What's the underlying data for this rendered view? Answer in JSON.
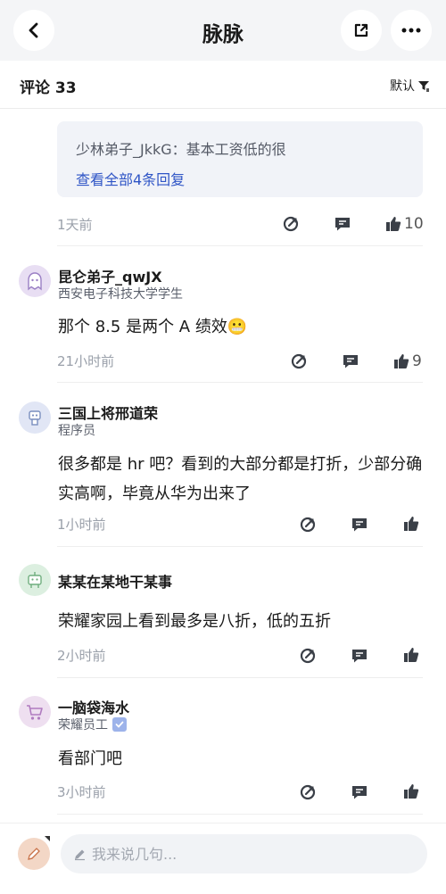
{
  "header": {
    "title": "脉脉"
  },
  "comments_header": {
    "title": "评论 33",
    "sort_label": "默认"
  },
  "thread": {
    "reply_preview": "少林弟子_JkkG：基本工资低的很",
    "view_all_replies": "查看全部4条回复",
    "time": "1天前",
    "like_count": "10"
  },
  "comments": [
    {
      "username": "昆仑弟子_qwJX",
      "subtitle": "西安电子科技大学学生",
      "text": "那个 8.5 是两个 A 绩效",
      "emoji": "😬",
      "time": "21小时前",
      "like_count": "9",
      "avatar_color": "#e8def3"
    },
    {
      "username": "三国上将邢道荣",
      "subtitle": "程序员",
      "text": "很多都是 hr 吧？看到的大部分都是打折，少部分确实高啊，毕竟从华为出来了",
      "time": "1小时前",
      "like_count": "",
      "avatar_color": "#e1e6f5"
    },
    {
      "username": "某某在某地干某事",
      "subtitle": "",
      "text": "荣耀家园上看到最多是八折，低的五折",
      "time": "2小时前",
      "like_count": "",
      "avatar_color": "#dcefe0"
    },
    {
      "username": "一脑袋海水",
      "subtitle": "荣耀员工",
      "text": "看部门吧",
      "time": "3小时前",
      "like_count": "",
      "avatar_color": "#eedff0"
    }
  ],
  "composer": {
    "placeholder": "我来说几句..."
  },
  "colors": {
    "accent_link": "#2f55c6",
    "background_top": "#f4f5f7"
  }
}
